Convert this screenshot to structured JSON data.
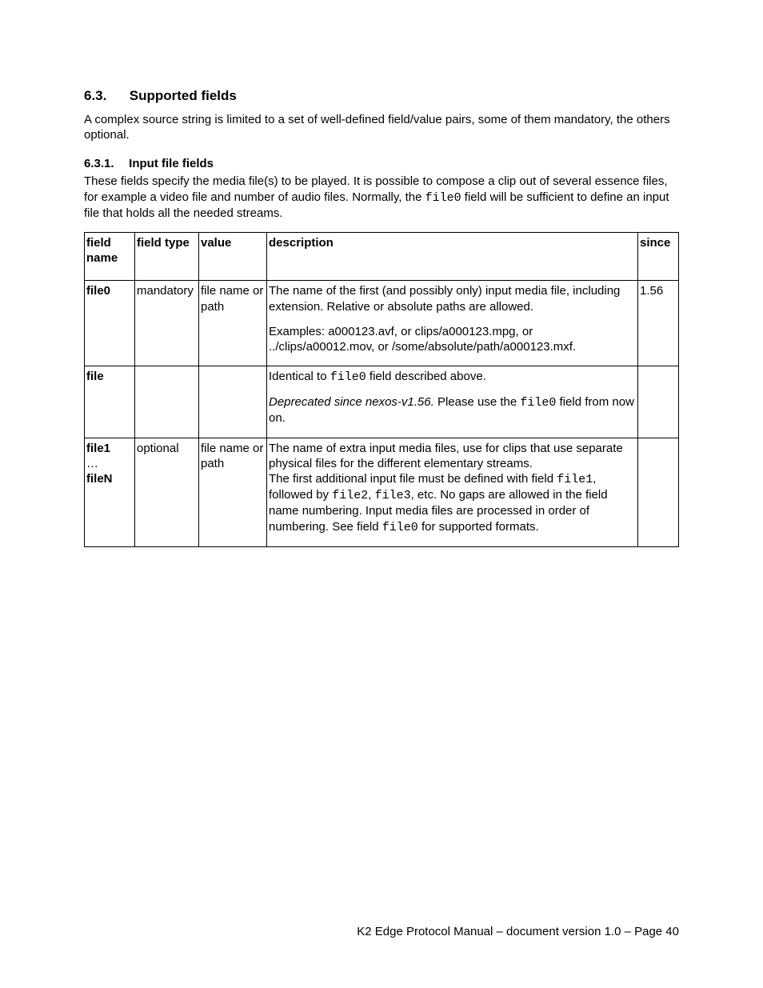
{
  "section": {
    "number": "6.3.",
    "title": "Supported fields",
    "intro": "A complex source string is limited to a set of well-defined field/value pairs, some of them mandatory, the others optional."
  },
  "subsection": {
    "number": "6.3.1.",
    "title": "Input file fields",
    "intro_pre": "These fields specify the media file(s) to be played. It is possible to compose a clip out of several essence files, for example   a video file and number of audio files. Normally, the ",
    "intro_code": "file0",
    "intro_post": " field will be sufficient to define an input file that holds all the needed streams."
  },
  "table": {
    "headers": {
      "field": "field name",
      "type": "field type",
      "value": "value",
      "desc": "description",
      "since": "since"
    },
    "row0": {
      "field": "file0",
      "type": "mandatory",
      "value": "file name or path",
      "desc_p1": "The name of the first (and possibly only) input media file, including extension. Relative or absolute paths are allowed.",
      "desc_p2": "Examples: a000123.avf, or clips/a000123.mpg, or ../clips/a00012.mov, or /some/absolute/path/a000123.mxf.",
      "since": "1.56"
    },
    "row1": {
      "field": "file",
      "type": "",
      "value": "",
      "d_a": "Identical to ",
      "d_b": "file0",
      "d_c": " field described above.",
      "d_d": "Deprecated since nexos-v1.56.",
      "d_e": " Please use the ",
      "d_f": "file0",
      "d_g": " field from now on.",
      "since": ""
    },
    "row2": {
      "field_l1": "file1",
      "field_l2": "…",
      "field_l3": "fileN",
      "type": "optional",
      "value": "file name or path",
      "d_a": "The name of extra input media files, use for clips that use separate physical files for the different elementary streams.",
      "d_b": "The first additional input file must be defined with field ",
      "d_c": "file1",
      "d_d": ", followed by ",
      "d_e": "file2",
      "d_f": ", ",
      "d_g": "file3",
      "d_h": ", etc. No gaps are allowed in the field name numbering. Input media files are processed in order of numbering. See field ",
      "d_i": "file0",
      "d_j": " for supported formats.",
      "since": ""
    }
  },
  "footer": "K2 Edge Protocol Manual – document version 1.0 – Page 40"
}
